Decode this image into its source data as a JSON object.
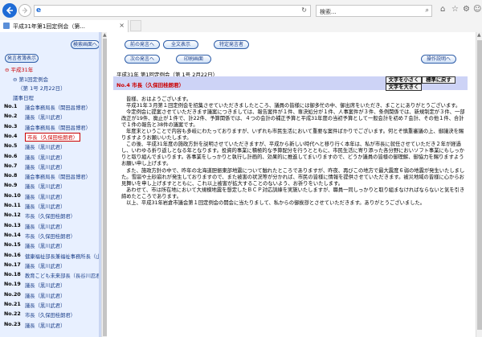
{
  "browser": {
    "search_placeholder": "検索...",
    "tab_title": "平成31年第1回定例会（第...",
    "tab_close": "×"
  },
  "left": {
    "search_button": "検索画面へ",
    "speaker_list_button": "発言者簿表示",
    "tree_year": "⊖ 平成31年",
    "tree_session": "⊖ 第1回定例会",
    "tree_day": "（第 1号 2月22日）",
    "tree_list": "議事日程",
    "speakers": [
      {
        "no": "No.1",
        "name": "議会事務局長（関田昌博君）",
        "active": false
      },
      {
        "no": "No.2",
        "name": "議長（黒川武君）",
        "active": false
      },
      {
        "no": "No.3",
        "name": "議会事務局長（関田昌博君）",
        "active": false
      },
      {
        "no": "No.4",
        "name": "市長（久保田桂朗君）",
        "active": true
      },
      {
        "no": "No.5",
        "name": "議長（黒川武君）",
        "active": false
      },
      {
        "no": "No.6",
        "name": "議長（黒川武君）",
        "active": false
      },
      {
        "no": "No.7",
        "name": "議長（黒川武君）",
        "active": false
      },
      {
        "no": "No.8",
        "name": "議会事務局長（関田昌博君）",
        "active": false
      },
      {
        "no": "No.9",
        "name": "議長（黒川武君）",
        "active": false
      },
      {
        "no": "No.10",
        "name": "議長（黒川武君）",
        "active": false
      },
      {
        "no": "No.11",
        "name": "議長（黒川武君）",
        "active": false
      },
      {
        "no": "No.12",
        "name": "市長（久保田桂朗君）",
        "active": false
      },
      {
        "no": "No.13",
        "name": "議長（黒川武君）",
        "active": false
      },
      {
        "no": "No.14",
        "name": "市長（久保田桂朗君）",
        "active": false
      },
      {
        "no": "No.15",
        "name": "議長（黒川武君）",
        "active": false
      },
      {
        "no": "No.16",
        "name": "健康福祉部長兼福祉事務所長（山出由",
        "active": false
      },
      {
        "no": "No.17",
        "name": "議長（黒川武君）",
        "active": false
      },
      {
        "no": "No.18",
        "name": "教育こども未来部長（長谷川忍君）",
        "active": false
      },
      {
        "no": "No.19",
        "name": "議長（黒川武君）",
        "active": false
      },
      {
        "no": "No.20",
        "name": "議長（黒川武君）",
        "active": false
      },
      {
        "no": "No.21",
        "name": "議長（黒川武君）",
        "active": false
      },
      {
        "no": "No.22",
        "name": "市長（久保田桂朗君）",
        "active": false
      },
      {
        "no": "No.23",
        "name": "議長（黒川武君）",
        "active": false
      }
    ]
  },
  "toolbar": {
    "prev_speaker": "前の発言へ",
    "full_text": "全文表示",
    "specific_speaker": "特定発言者",
    "next_speaker": "次の発言へ",
    "print_screen": "印刷画面",
    "help": "操作説明へ"
  },
  "content": {
    "meta": "平成31年 第1回定例会（第 1号 2月22日）",
    "speaker": "No.4 市長（久保田桂朗君）",
    "font_small": "文字を小さく",
    "font_reset": "標準に戻す",
    "font_large": "文字を大きく",
    "paragraphs": [
      "皆様、おはようございます。",
      "平成31年３月第１回定例会を招集させていただきましたところ、議員の皆様には御多忙の中、御出席をいただき、まことにありがとうございます。",
      "今定例会に提案させていただきます議案につきましては、報告案件が１件、専決処分が１件、人事案件が３件、条例関係では、新規制定が３件、一部改正が19件、廃止が１件で、計22件、予算関係では、４つの会計の補正予算と平成31年度の当初予算として一般会計を初め７会計、その他１件、合計で１件の報告と38件の議案です。",
      "年度末ということで内容も多岐にわたっておりますが、いずれも市民生活において重要な案件ばかりでございます。何とぞ慎重審議の上、御議決を賜りますようお願いいたします。",
      "この後、平成31年度の施政方針を説明させていただきますが、平成から新しい時代へと移り行く本年は、私が市長に就任させていただき２年が経過し、いわゆる折り返しとなる年となります。投資的事業に積極的な予算配分を行うとともに、市民生活に寄り添った各分野においソフト事業にもしっかりと取り組んでまいります。各事業をしっかりと執行し計画的、効果的に推進してまいりますので、どうか議員の皆様の御理解、御協力を賜りますようお願い申し上げます。",
      "また、施政方針の中で、昨年の北海道胆振東部地震について触れたところでありますが、昨夜、再びこの地方で最大震度６弱の地震が発生いたしました。雪崩や土砂崩れが発生しておりますので、また被害の状況等が分かれば、市民の皆様に情報を提供させていただきます。被災地域の皆様に心からお見舞いを申し上げますとともに、これ以上被害が拡大することのないよう、お祈りをいたします。",
      "あわせて、市は所在地において大規模地震を想定したＢＣＰ対応訓練を実施いたしますが、職員一同しっかりと取り組まなければならないと気を引き締めたところであります。",
      "以上、平成31年岩倉市議会第１回定例会の開会に当たりまして、私からの御挨拶とさせていただきます。ありがとうございました。"
    ]
  }
}
